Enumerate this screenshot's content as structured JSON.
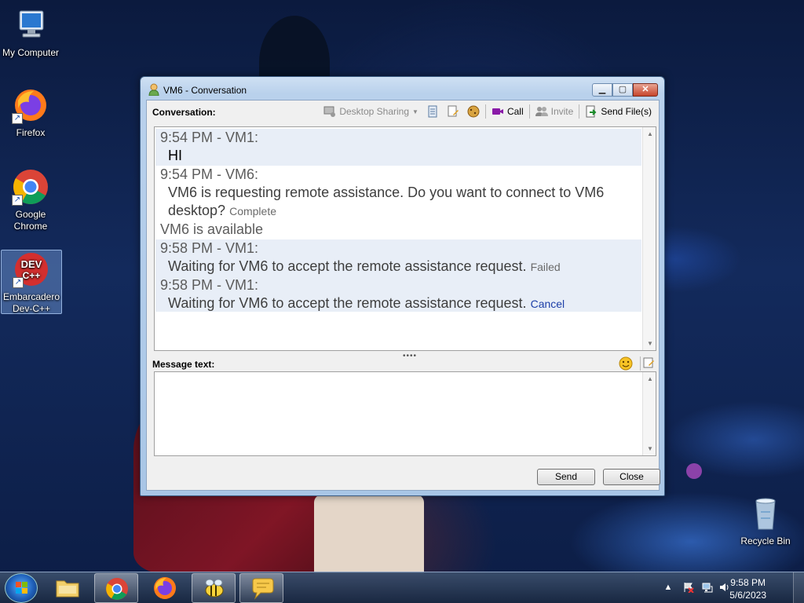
{
  "desktop": {
    "icons": [
      {
        "label": "My Computer"
      },
      {
        "label": "Firefox"
      },
      {
        "label": "Google Chrome"
      },
      {
        "label": "Embarcadero Dev-C++"
      },
      {
        "label": "Recycle Bin"
      }
    ]
  },
  "window": {
    "title": "VM6 - Conversation",
    "conversation_label": "Conversation:",
    "toolbar": {
      "desktop_sharing": "Desktop Sharing",
      "call": "Call",
      "invite": "Invite",
      "send_files": "Send File(s)"
    },
    "messages": [
      {
        "header": "9:54 PM - VM1:",
        "text": "HI"
      },
      {
        "header": "9:54 PM - VM6:",
        "text_line1": "VM6 is requesting remote assistance. Do you want to connect to VM6",
        "text_line2": "desktop?",
        "status": "Complete"
      },
      {
        "status_line": "VM6 is available"
      },
      {
        "header": "9:58 PM - VM1:",
        "text": "Waiting for VM6 to accept the remote assistance request.",
        "status": "Failed"
      },
      {
        "header": "9:58 PM - VM1:",
        "text": "Waiting for VM6 to accept the remote assistance request.",
        "action": "Cancel"
      }
    ],
    "message_text_label": "Message text:",
    "message_value": "",
    "send_label": "Send",
    "close_label": "Close"
  },
  "taskbar": {
    "clock_time": "9:58 PM",
    "clock_date": "5/6/2023"
  }
}
